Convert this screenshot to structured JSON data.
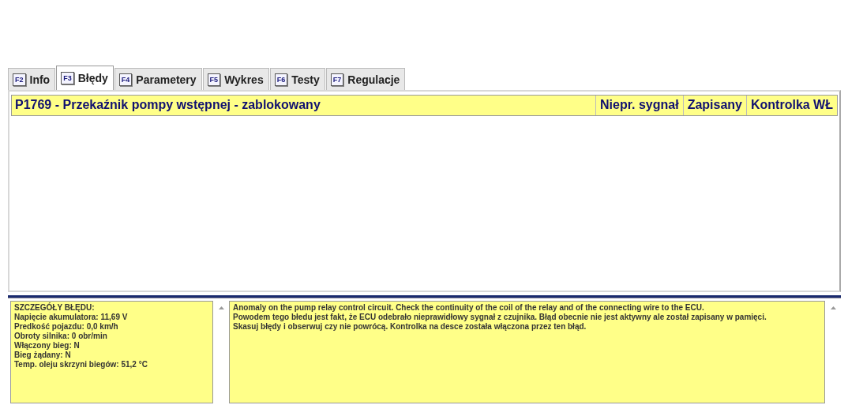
{
  "tabs": [
    {
      "key": "F2",
      "label": "Info",
      "selected": false
    },
    {
      "key": "F3",
      "label": "Błędy",
      "selected": true
    },
    {
      "key": "F4",
      "label": "Parametery",
      "selected": false
    },
    {
      "key": "F5",
      "label": "Wykres",
      "selected": false
    },
    {
      "key": "F6",
      "label": "Testy",
      "selected": false
    },
    {
      "key": "F7",
      "label": "Regulacje",
      "selected": false
    }
  ],
  "fault": {
    "title": "P1769 - Przekaźnik pompy wstępnej - zablokowany",
    "columns": [
      "Niepr. sygnał",
      "Zapisany",
      "Kontrolka WŁ"
    ]
  },
  "details": {
    "lines": [
      "SZCZEGÓŁY BŁĘDU:",
      "Napięcie akumulatora: 11,69 V",
      "Predkość pojazdu: 0,0 km/h",
      "Obroty silnika: 0 obr/min",
      "Włączony bieg: N",
      "Bieg żądany: N",
      "Temp. oleju skrzyni biegów: 51,2 °C"
    ]
  },
  "description": {
    "lines": [
      "Anomaly on the pump relay control circuit. Check the continuity of the coil of the relay and of the connecting wire to the ECU.",
      "Powodem tego błedu jest fakt, że ECU odebrało nieprawidłowy sygnał z czujnika. Błąd obecnie nie jest aktywny ale został zapisany w pamięci.",
      "Skasuj błędy i obserwuj czy nie powrócą. Kontrolka na desce została włączona przez ten błąd."
    ]
  }
}
